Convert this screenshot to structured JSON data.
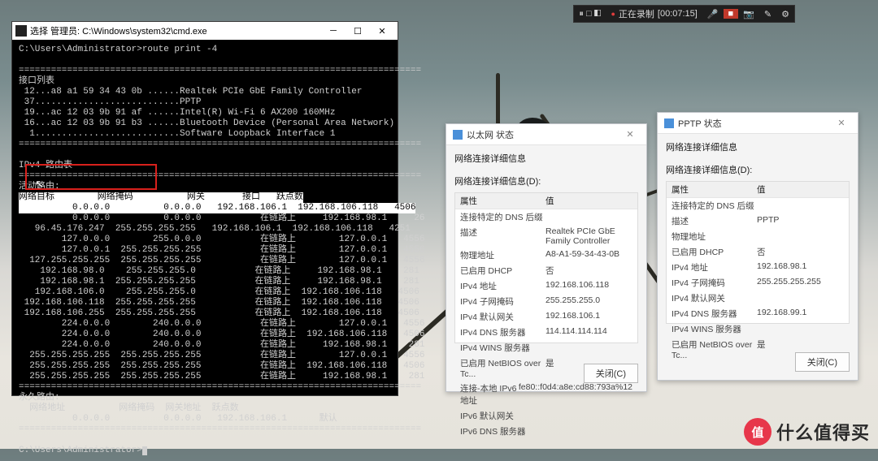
{
  "capture_bar": {
    "rec_sym": "●",
    "seg1": "⏸ □ ◧",
    "rec_label": "正在录制",
    "timer": "[00:07:15]",
    "mic": "🎤",
    "stop": "■",
    "cam": "📷",
    "pen": "✎",
    "gear": "⚙"
  },
  "cmd": {
    "title": "选择 管理员: C:\\Windows\\system32\\cmd.exe",
    "prompt1": "C:\\Users\\Administrator>route print -4",
    "iface_header": "接口列表",
    "iface": [
      " 12...a8 a1 59 34 43 0b ......Realtek PCIe GbE Family Controller",
      " 37...........................PPTP",
      " 19...ac 12 03 9b 91 af ......Intel(R) Wi-Fi 6 AX200 160MHz",
      " 16...ac 12 03 9b 91 b3 ......Bluetooth Device (Personal Area Network)",
      "  1...........................Software Loopback Interface 1"
    ],
    "sep": "===========================================================================",
    "v4_header": "IPv4 路由表",
    "active_header": "活动路由:",
    "col_header": "网络目标        网络掩码          网关       接口   跃点数",
    "routes_sel": "          0.0.0.0          0.0.0.0   192.168.106.1  192.168.106.118   4506",
    "routes": [
      "          0.0.0.0          0.0.0.0           在链路上     192.168.98.1     26",
      "   96.45.176.247  255.255.255.255   192.168.106.1  192.168.106.118   4251",
      "        127.0.0.0        255.0.0.0           在链路上        127.0.0.1   4556",
      "        127.0.0.1  255.255.255.255           在链路上        127.0.0.1   4556",
      "  127.255.255.255  255.255.255.255           在链路上        127.0.0.1   4556",
      "    192.168.98.0    255.255.255.0           在链路上     192.168.98.1    281",
      "    192.168.98.1  255.255.255.255           在链路上     192.168.98.1    281",
      "   192.168.106.0    255.255.255.0           在链路上  192.168.106.118   4506",
      " 192.168.106.118  255.255.255.255           在链路上  192.168.106.118   4506",
      " 192.168.106.255  255.255.255.255           在链路上  192.168.106.118   4506",
      "        224.0.0.0        240.0.0.0           在链路上        127.0.0.1   4556",
      "        224.0.0.0        240.0.0.0           在链路上  192.168.106.118   4506",
      "        224.0.0.0        240.0.0.0           在链路上     192.168.98.1    281",
      "  255.255.255.255  255.255.255.255           在链路上        127.0.0.1   4556",
      "  255.255.255.255  255.255.255.255           在链路上  192.168.106.118   4506",
      "  255.255.255.255  255.255.255.255           在链路上     192.168.98.1    281"
    ],
    "perm_header": "永久路由:",
    "perm_cols": "  网络地址          网络掩码  网关地址  跃点数",
    "perm_row": "          0.0.0.0          0.0.0.0   192.168.106.1      默认",
    "prompt2": "C:\\Users\\Administrator>"
  },
  "dlg1": {
    "title": "以太网 状态",
    "subtitle": "网络连接详细信息",
    "section": "网络连接详细信息(D):",
    "head_k": "属性",
    "head_v": "值",
    "rows": [
      {
        "k": "连接特定的 DNS 后缀",
        "v": ""
      },
      {
        "k": "描述",
        "v": "Realtek PCIe GbE Family Controller"
      },
      {
        "k": "物理地址",
        "v": "A8-A1-59-34-43-0B"
      },
      {
        "k": "已启用 DHCP",
        "v": "否"
      },
      {
        "k": "IPv4 地址",
        "v": "192.168.106.118"
      },
      {
        "k": "IPv4 子网掩码",
        "v": "255.255.255.0"
      },
      {
        "k": "IPv4 默认网关",
        "v": "192.168.106.1"
      },
      {
        "k": "IPv4 DNS 服务器",
        "v": "114.114.114.114"
      },
      {
        "k": "IPv4 WINS 服务器",
        "v": ""
      },
      {
        "k": "已启用 NetBIOS over Tc...",
        "v": "是"
      },
      {
        "k": "连接-本地 IPv6 地址",
        "v": "fe80::f0d4:a8e:cd88:793a%12"
      },
      {
        "k": "IPv6 默认网关",
        "v": ""
      },
      {
        "k": "IPv6 DNS 服务器",
        "v": ""
      }
    ],
    "close_btn": "关闭(C)"
  },
  "dlg2": {
    "title": "PPTP 状态",
    "subtitle": "网络连接详细信息",
    "section": "网络连接详细信息(D):",
    "head_k": "属性",
    "head_v": "值",
    "rows": [
      {
        "k": "连接特定的 DNS 后缀",
        "v": ""
      },
      {
        "k": "描述",
        "v": "PPTP"
      },
      {
        "k": "物理地址",
        "v": ""
      },
      {
        "k": "已启用 DHCP",
        "v": "否"
      },
      {
        "k": "IPv4 地址",
        "v": "192.168.98.1"
      },
      {
        "k": "IPv4 子网掩码",
        "v": "255.255.255.255"
      },
      {
        "k": "IPv4 默认网关",
        "v": ""
      },
      {
        "k": "IPv4 DNS 服务器",
        "v": "192.168.99.1"
      },
      {
        "k": "IPv4 WINS 服务器",
        "v": ""
      },
      {
        "k": "已启用 NetBIOS over Tc...",
        "v": "是"
      }
    ],
    "close_btn": "关闭(C)"
  },
  "watermark": {
    "badge": "值",
    "text": "什么值得买"
  }
}
